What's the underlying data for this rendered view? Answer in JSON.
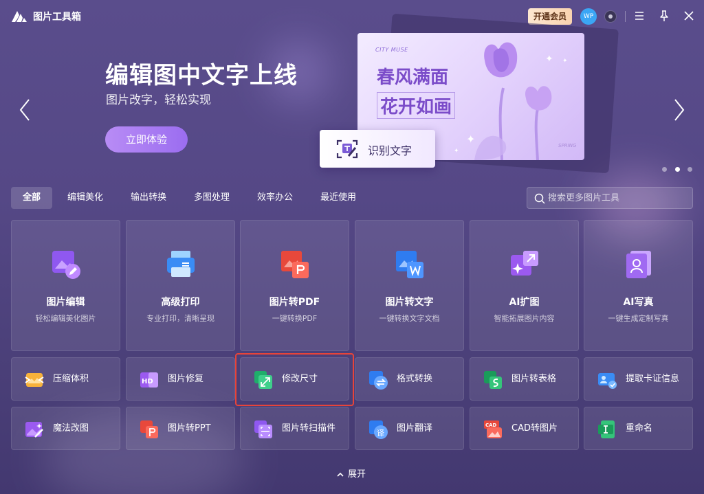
{
  "app": {
    "title": "图片工具箱"
  },
  "header": {
    "vip_label": "开通会员",
    "avatar_text": "WP"
  },
  "banner": {
    "title": "编辑图中文字上线",
    "subtitle": "图片改字，轻松实现",
    "cta_label": "立即体验",
    "card": {
      "top_tag": "CITY  MUSE",
      "line1": "春风满面",
      "line2": "花开如画",
      "bottom_tag": "SPRING"
    },
    "ocr_label": "识别文字",
    "active_dot": 1
  },
  "tabs": [
    {
      "label": "全部",
      "active": true
    },
    {
      "label": "编辑美化",
      "active": false
    },
    {
      "label": "输出转换",
      "active": false
    },
    {
      "label": "多图处理",
      "active": false
    },
    {
      "label": "效率办公",
      "active": false
    },
    {
      "label": "最近使用",
      "active": false
    }
  ],
  "search": {
    "placeholder": "搜索更多图片工具"
  },
  "featured_tools": [
    {
      "title": "图片编辑",
      "desc": "轻松编辑美化图片",
      "icon": "image-edit-icon"
    },
    {
      "title": "高级打印",
      "desc": "专业打印，清晰呈现",
      "icon": "printer-icon"
    },
    {
      "title": "图片转PDF",
      "desc": "一键转换PDF",
      "icon": "image-to-pdf-icon"
    },
    {
      "title": "图片转文字",
      "desc": "一键转换文字文档",
      "icon": "image-to-word-icon"
    },
    {
      "title": "AI扩图",
      "desc": "智能拓展图片内容",
      "icon": "ai-expand-icon"
    },
    {
      "title": "AI写真",
      "desc": "一键生成定制写真",
      "icon": "ai-portrait-icon"
    }
  ],
  "tools_row1": [
    {
      "label": "压缩体积",
      "icon": "compress-icon"
    },
    {
      "label": "图片修复",
      "icon": "hd-repair-icon"
    },
    {
      "label": "修改尺寸",
      "icon": "resize-icon"
    },
    {
      "label": "格式转换",
      "icon": "format-convert-icon"
    },
    {
      "label": "图片转表格",
      "icon": "image-to-sheet-icon"
    },
    {
      "label": "提取卡证信息",
      "icon": "id-card-icon"
    }
  ],
  "tools_row2": [
    {
      "label": "魔法改图",
      "icon": "magic-edit-icon"
    },
    {
      "label": "图片转PPT",
      "icon": "image-to-ppt-icon"
    },
    {
      "label": "图片转扫描件",
      "icon": "scan-icon"
    },
    {
      "label": "图片翻译",
      "icon": "translate-icon"
    },
    {
      "label": "CAD转图片",
      "icon": "cad-icon"
    },
    {
      "label": "重命名",
      "icon": "rename-icon"
    }
  ],
  "expand_label": "展开",
  "colors": {
    "accent": "#9b6df0",
    "highlight": "#e7443a",
    "vip_bg": "#fde7d0"
  }
}
